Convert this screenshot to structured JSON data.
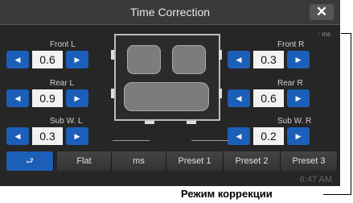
{
  "window": {
    "title": "Time Correction",
    "close_icon": "close-icon"
  },
  "unit_label": ": ms",
  "left": {
    "front": {
      "label": "Front L",
      "value": "0.6"
    },
    "rear": {
      "label": "Rear L",
      "value": "0.9"
    },
    "sub": {
      "label": "Sub W. L",
      "value": "0.3"
    }
  },
  "right": {
    "front": {
      "label": "Front R",
      "value": "0.3"
    },
    "rear": {
      "label": "Rear R",
      "value": "0.6"
    },
    "sub": {
      "label": "Sub W. R",
      "value": "0.2"
    }
  },
  "bottom": {
    "back_icon": "return-arrow-icon",
    "flat": "Flat",
    "ms": "ms",
    "preset1": "Preset 1",
    "preset2": "Preset 2",
    "preset3": "Preset 3"
  },
  "clock": "6:47 AM",
  "caption": "Режим коррекции",
  "colors": {
    "accent": "#1c5fb8",
    "background": "#262626"
  }
}
